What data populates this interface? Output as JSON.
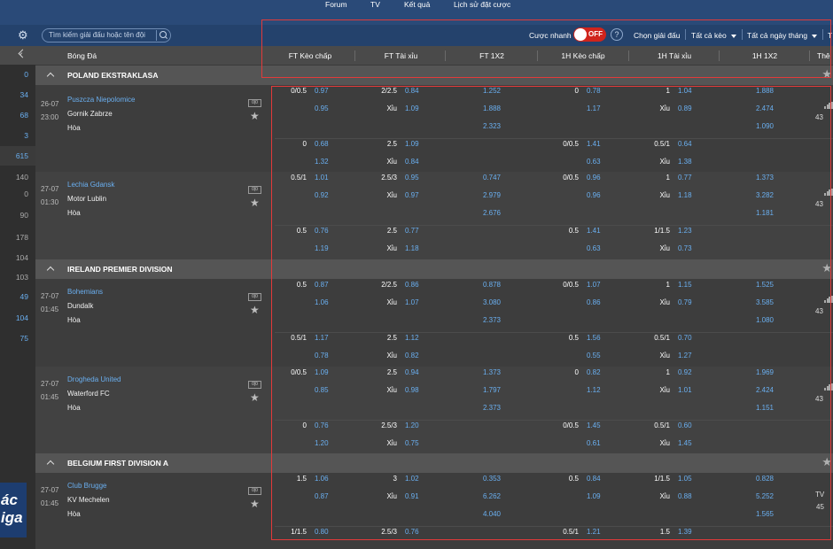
{
  "nav": {
    "links": [
      "Forum",
      "TV",
      "Kết quả",
      "Lịch sử đặt cược"
    ]
  },
  "toolbar": {
    "search_placeholder": "Tìm kiếm giải đấu hoặc tên đội",
    "quick_bet_label": "Cược nhanh",
    "quick_bet_state": "OFF",
    "help": "?",
    "select_league": "Chọn giải đấu",
    "all_types": "Tất cả kèo",
    "all_dates": "Tất cả ngày tháng",
    "cut": "T"
  },
  "columns": {
    "sport": "Bóng Đá",
    "ft_handicap": "FT Kèo chấp",
    "ft_ou": "FT Tài xỉu",
    "ft_1x2": "FT 1X2",
    "h1_handicap": "1H Kèo chấp",
    "h1_ou": "1H Tài xỉu",
    "h1_1x2": "1H 1X2",
    "more": "Thê"
  },
  "sidebar_counts": [
    "0",
    "34",
    "68",
    "3",
    "615",
    "140",
    "0",
    "90",
    "178",
    "104",
    "103",
    "49",
    "104",
    "75"
  ],
  "logo_text": [
    "ác",
    "iga"
  ],
  "leagues": [
    "POLAND EKSTRAKLASA",
    "IRELAND PREMIER DIVISION",
    "BELGIUM FIRST DIVISION A"
  ],
  "matches": [
    {
      "date": "26-07",
      "time": "23:00",
      "home": "Puszcza Niepolomice",
      "away": "Gornik Zabrze",
      "draw": "Hòa",
      "count": "43",
      "rows": [
        {
          "ft_h": [
            "0/0.5",
            "0.97",
            "",
            "0.95"
          ],
          "ft_ou": [
            "2/2.5",
            "0.84",
            "Xỉu",
            "1.09"
          ],
          "ft_1x2": [
            "1.252",
            "1.888",
            "2.323"
          ],
          "h1_h": [
            "0",
            "0.78",
            "",
            "1.17"
          ],
          "h1_ou": [
            "1",
            "1.04",
            "Xỉu",
            "0.89"
          ],
          "h1_1x2": [
            "1.888",
            "2.474",
            "1.090"
          ]
        },
        {
          "ft_h": [
            "0",
            "0.68",
            "",
            "1.32"
          ],
          "ft_ou": [
            "2.5",
            "1.09",
            "Xỉu",
            "0.84"
          ],
          "ft_1x2": [
            "",
            "",
            ""
          ],
          "h1_h": [
            "0/0.5",
            "1.41",
            "",
            "0.63"
          ],
          "h1_ou": [
            "0.5/1",
            "0.64",
            "Xỉu",
            "1.38"
          ],
          "h1_1x2": [
            "",
            "",
            ""
          ]
        }
      ]
    },
    {
      "date": "27-07",
      "time": "01:30",
      "home": "Lechia Gdansk",
      "away": "Motor Lublin",
      "draw": "Hòa",
      "count": "43",
      "rows": [
        {
          "ft_h": [
            "0.5/1",
            "1.01",
            "",
            "0.92"
          ],
          "ft_ou": [
            "2.5/3",
            "0.95",
            "Xỉu",
            "0.97"
          ],
          "ft_1x2": [
            "0.747",
            "2.979",
            "2.676"
          ],
          "h1_h": [
            "0/0.5",
            "0.96",
            "",
            "0.96"
          ],
          "h1_ou": [
            "1",
            "0.77",
            "Xỉu",
            "1.18"
          ],
          "h1_1x2": [
            "1.373",
            "3.282",
            "1.181"
          ]
        },
        {
          "ft_h": [
            "0.5",
            "0.76",
            "",
            "1.19"
          ],
          "ft_ou": [
            "2.5",
            "0.77",
            "Xỉu",
            "1.18"
          ],
          "ft_1x2": [
            "",
            "",
            ""
          ],
          "h1_h": [
            "0.5",
            "1.41",
            "",
            "0.63"
          ],
          "h1_ou": [
            "1/1.5",
            "1.23",
            "Xỉu",
            "0.73"
          ],
          "h1_1x2": [
            "",
            "",
            ""
          ]
        }
      ]
    },
    {
      "date": "27-07",
      "time": "01:45",
      "home": "Bohemians",
      "away": "Dundalk",
      "draw": "Hòa",
      "count": "43",
      "rows": [
        {
          "ft_h": [
            "0.5",
            "0.87",
            "",
            "1.06"
          ],
          "ft_ou": [
            "2/2.5",
            "0.86",
            "Xỉu",
            "1.07"
          ],
          "ft_1x2": [
            "0.878",
            "3.080",
            "2.373"
          ],
          "h1_h": [
            "0/0.5",
            "1.07",
            "",
            "0.86"
          ],
          "h1_ou": [
            "1",
            "1.15",
            "Xỉu",
            "0.79"
          ],
          "h1_1x2": [
            "1.525",
            "3.585",
            "1.080"
          ]
        },
        {
          "ft_h": [
            "0.5/1",
            "1.17",
            "",
            "0.78"
          ],
          "ft_ou": [
            "2.5",
            "1.12",
            "Xỉu",
            "0.82"
          ],
          "ft_1x2": [
            "",
            "",
            ""
          ],
          "h1_h": [
            "0.5",
            "1.56",
            "",
            "0.55"
          ],
          "h1_ou": [
            "0.5/1",
            "0.70",
            "Xỉu",
            "1.27"
          ],
          "h1_1x2": [
            "",
            "",
            ""
          ]
        }
      ]
    },
    {
      "date": "27-07",
      "time": "01:45",
      "home": "Drogheda United",
      "away": "Waterford FC",
      "draw": "Hòa",
      "count": "43",
      "rows": [
        {
          "ft_h": [
            "0/0.5",
            "1.09",
            "",
            "0.85"
          ],
          "ft_ou": [
            "2.5",
            "0.94",
            "Xỉu",
            "0.98"
          ],
          "ft_1x2": [
            "1.373",
            "1.797",
            "2.373"
          ],
          "h1_h": [
            "0",
            "0.82",
            "",
            "1.12"
          ],
          "h1_ou": [
            "1",
            "0.92",
            "Xỉu",
            "1.01"
          ],
          "h1_1x2": [
            "1.969",
            "2.424",
            "1.151"
          ]
        },
        {
          "ft_h": [
            "0",
            "0.76",
            "",
            "1.20"
          ],
          "ft_ou": [
            "2.5/3",
            "1.20",
            "Xỉu",
            "0.75"
          ],
          "ft_1x2": [
            "",
            "",
            ""
          ],
          "h1_h": [
            "0/0.5",
            "1.45",
            "",
            "0.61"
          ],
          "h1_ou": [
            "0.5/1",
            "0.60",
            "Xỉu",
            "1.45"
          ],
          "h1_1x2": [
            "",
            "",
            ""
          ]
        }
      ]
    },
    {
      "date": "27-07",
      "time": "01:45",
      "home": "Club Brugge",
      "away": "KV Mechelen",
      "draw": "Hòa",
      "count": "45",
      "tv": "TV",
      "rows": [
        {
          "ft_h": [
            "1.5",
            "1.06",
            "",
            "0.87"
          ],
          "ft_ou": [
            "3",
            "1.02",
            "Xỉu",
            "0.91"
          ],
          "ft_1x2": [
            "0.353",
            "6.262",
            "4.040"
          ],
          "h1_h": [
            "0.5",
            "0.84",
            "",
            "1.09"
          ],
          "h1_ou": [
            "1/1.5",
            "1.05",
            "Xỉu",
            "0.88"
          ],
          "h1_1x2": [
            "0.828",
            "5.252",
            "1.565"
          ]
        },
        {
          "ft_h": [
            "1/1.5",
            "0.80",
            "",
            ""
          ],
          "ft_ou": [
            "2.5/3",
            "0.76",
            "",
            ""
          ],
          "ft_1x2": [
            "",
            "",
            ""
          ],
          "h1_h": [
            "0.5/1",
            "1.21",
            "",
            ""
          ],
          "h1_ou": [
            "1.5",
            "1.39",
            "",
            ""
          ],
          "h1_1x2": [
            "",
            "",
            ""
          ]
        }
      ]
    }
  ],
  "colors": {
    "nav_bg": "#2a4a78",
    "toolbar_bg": "#24426c",
    "odds_blue": "#6aaff0",
    "toggle_red": "#d0241c",
    "highlight_red": "#e23a3a"
  }
}
